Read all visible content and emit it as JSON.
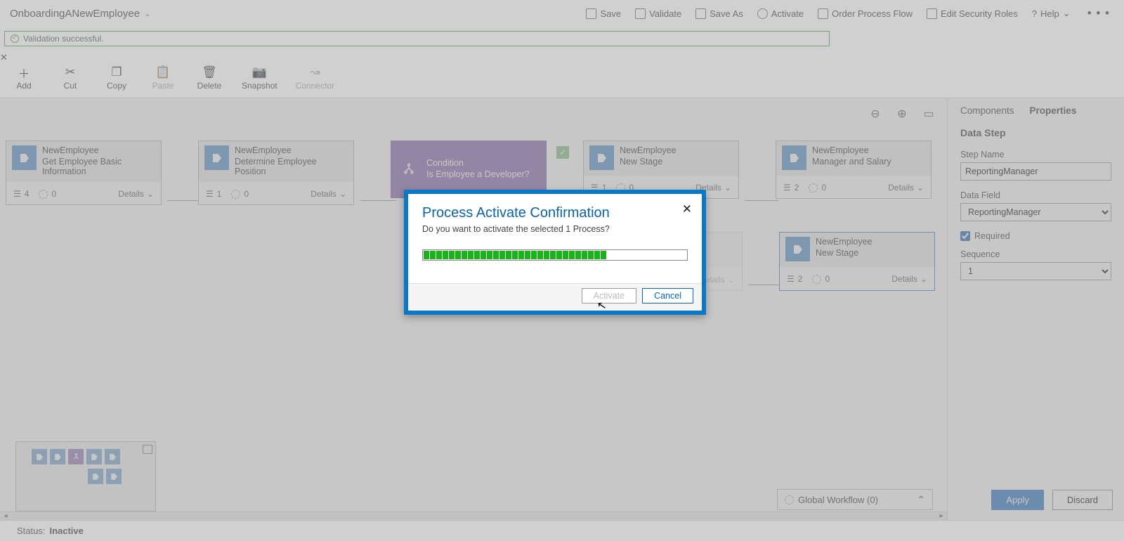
{
  "header": {
    "processName": "OnboardingANewEmployee",
    "actions": {
      "save": "Save",
      "validate": "Validate",
      "saveAs": "Save As",
      "activate": "Activate",
      "orderProcess": "Order Process Flow",
      "editSecurity": "Edit Security Roles",
      "help": "Help"
    }
  },
  "validation": {
    "message": "Validation successful."
  },
  "toolbar": {
    "add": "Add",
    "cut": "Cut",
    "copy": "Copy",
    "paste": "Paste",
    "delete": "Delete",
    "snapshot": "Snapshot",
    "connector": "Connector"
  },
  "nodes": {
    "n1": {
      "entity": "NewEmployee",
      "title": "Get Employee Basic Information",
      "steps": "4",
      "wf": "0",
      "details": "Details"
    },
    "n2": {
      "entity": "NewEmployee",
      "title": "Determine Employee Position",
      "steps": "1",
      "wf": "0",
      "details": "Details"
    },
    "n3": {
      "entity": "Condition",
      "title": "Is Employee a Developer?"
    },
    "n4": {
      "entity": "NewEmployee",
      "title": "New Stage",
      "steps": "1",
      "wf": "0",
      "details": "Details"
    },
    "n5": {
      "entity": "NewEmployee",
      "title": "Manager and Salary",
      "steps": "2",
      "wf": "0",
      "details": "Details"
    },
    "n6": {
      "entity": "",
      "title": "",
      "steps": "",
      "wf": "",
      "details": "Details"
    },
    "n7": {
      "entity": "NewEmployee",
      "title": "New Stage",
      "steps": "2",
      "wf": "0",
      "details": "Details"
    }
  },
  "globalWorkflow": {
    "label": "Global Workflow (0)"
  },
  "props": {
    "tabComponents": "Components",
    "tabProperties": "Properties",
    "heading": "Data Step",
    "stepNameLabel": "Step Name",
    "stepName": "ReportingManager",
    "dataFieldLabel": "Data Field",
    "dataField": "ReportingManager",
    "requiredLabel": "Required",
    "sequenceLabel": "Sequence",
    "sequence": "1",
    "apply": "Apply",
    "discard": "Discard"
  },
  "status": {
    "label": "Status:",
    "value": "Inactive"
  },
  "modal": {
    "title": "Process Activate Confirmation",
    "message": "Do you want to activate the selected 1 Process?",
    "activate": "Activate",
    "cancel": "Cancel",
    "progressPct": 73
  }
}
